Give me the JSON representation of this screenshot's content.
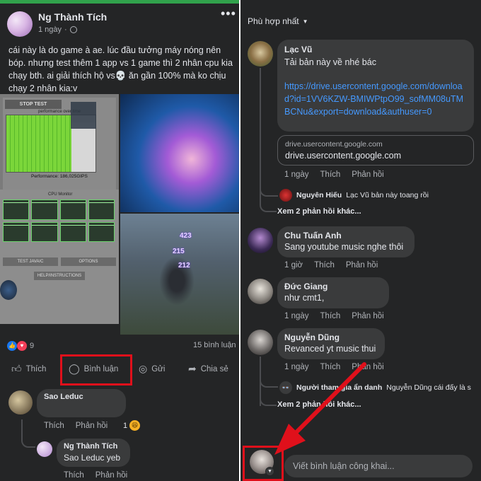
{
  "post": {
    "author": "Ng Thành Tích",
    "time": "1 ngày",
    "text": "cái này là do game à ae. lúc đầu tưởng máy nóng nên bóp. nhưng test thêm 1 app vs 1 game thì 2 nhân cpu kia chạy bth. ai giải thích hộ vs💀 ăn gần 100% mà ko chịu chạy 2 nhân kia:v",
    "image": {
      "stop_test": "STOP TEST",
      "performance_title": "performance over time",
      "performance": "Performance: 186,025GIPS",
      "cpu_monitor": "CPU Monitor",
      "test_java": "TEST JAVA/C",
      "options": "OPTIONS",
      "help": "HELP/INSTRUCTIONS",
      "damage_numbers": [
        "423",
        "215",
        "212"
      ]
    },
    "reaction_count": "9",
    "comment_count": "15 bình luận",
    "actions": {
      "like": "Thích",
      "comment": "Bình luận",
      "send": "Gửi",
      "share": "Chia sẻ"
    }
  },
  "left_comments": [
    {
      "name": "Sao Leduc",
      "like": "Thích",
      "reply": "Phản hồi",
      "reaction_count": "1"
    },
    {
      "name": "Ng Thành Tích",
      "text": "Sao Leduc yeb",
      "like": "Thích",
      "reply": "Phản hồi"
    }
  ],
  "right": {
    "sort_label": "Phù hợp nhất",
    "comments": [
      {
        "name": "Lạc Vũ",
        "text": "Tải bản này về nhé bác",
        "link": "https://drive.usercontent.google.com/download?id=1VV6KZW-BMIWPtpO99_sofMM08uTMBCNu&export=download&authuser=0",
        "link_card_domain": "drive.usercontent.google.com",
        "link_card_title": "drive.usercontent.google.com",
        "time": "1 ngày",
        "like": "Thích",
        "reply": "Phản hồi",
        "sub_reply_name": "Nguyên Hiếu",
        "sub_reply_text": "Lạc Vũ bản này toang rồi",
        "more_replies": "Xem 2 phản hồi khác..."
      },
      {
        "name": "Chu Tuấn Anh",
        "text": "Sang youtube music nghe thôi",
        "time": "1 giờ",
        "like": "Thích",
        "reply": "Phản hồi"
      },
      {
        "name": "Đức Giang",
        "text": "như cmt1,",
        "time": "1 ngày",
        "like": "Thích",
        "reply": "Phản hồi"
      },
      {
        "name": "Nguyễn Dũng",
        "text": "Revanced yt music thui",
        "time": "1 ngày",
        "like": "Thích",
        "reply": "Phản hồi",
        "sub_reply_name": "Người tham gia ẩn danh",
        "sub_reply_text": "Nguyễn Dũng cái đấy là s",
        "more_replies": "Xem 2 phản hồi khác..."
      }
    ],
    "composer_placeholder": "Viết bình luận công khai..."
  },
  "colors": {
    "background": "#242526",
    "bubble": "#3a3b3c",
    "text": "#e4e6eb",
    "secondary_text": "#b0b3b8",
    "link": "#4599ff",
    "highlight_box": "#e0101b",
    "arrow": "#e0101b",
    "top_bar": "#31a24c"
  }
}
